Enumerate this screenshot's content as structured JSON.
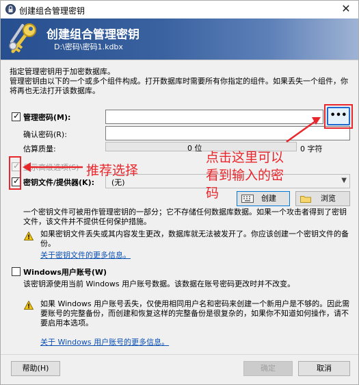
{
  "window": {
    "title": "创建组合管理密钥",
    "close": "✕"
  },
  "banner": {
    "title": "创建组合管理密钥",
    "path": "D:\\密码\\密码1.kdbx"
  },
  "intro": "指定管理密钥用于加密数据库。",
  "description": "管理密钥由以下的一个或多个组件构成。打开数据库时需要所有你指定的组件。如果丢失一个组件，你将再也无法打开该数据库。",
  "master_password": {
    "label": "管理密码(M):",
    "confirm_label": "确认密码(R):",
    "quality_label": "估算质量:",
    "quality_bits": "0 位",
    "char_count": "0 字符",
    "show_button": "•••"
  },
  "advanced_options": {
    "label": "显示高级选项(S)"
  },
  "key_file": {
    "label": "密钥文件/提供器(K):",
    "selected": "(无)",
    "create_button": "创建",
    "browse_button": "浏览",
    "description": "一个密钥文件可被用作管理密钥的一部分；它不存储任何数据库数据。如果一个攻击者得到了密钥文件，该文件并不提供任何保护措施。",
    "warning": "如果密钥文件丢失或其内容发生更改，数据库就无法被发开了。你应该创建一个密钥文件的备份。",
    "more_link": "关于密钥文件的更多信息。"
  },
  "windows_account": {
    "label": "Windows用户账号(W)",
    "description": "该密钥源使用当前 Windows 用户账号数据。该数据在账号密码更改时并不改变。",
    "warning": "如果 Windows 用户账号丢失，仅使用相同用户名和密码来创建一个新用户是不够的。因此需要账号的完整备份，而创建和恢复这样的完整备份是很复杂的，如果你不知道如何操作，请不要启用本选项。",
    "more_link": "关于 Windows 用户账号的更多信息。"
  },
  "footer": {
    "help": "帮助(H)",
    "ok": "确定",
    "cancel": "取消"
  },
  "annotations": {
    "recommend": "推荐选择",
    "click_hint": "点击这里可以看到输入的密码"
  }
}
